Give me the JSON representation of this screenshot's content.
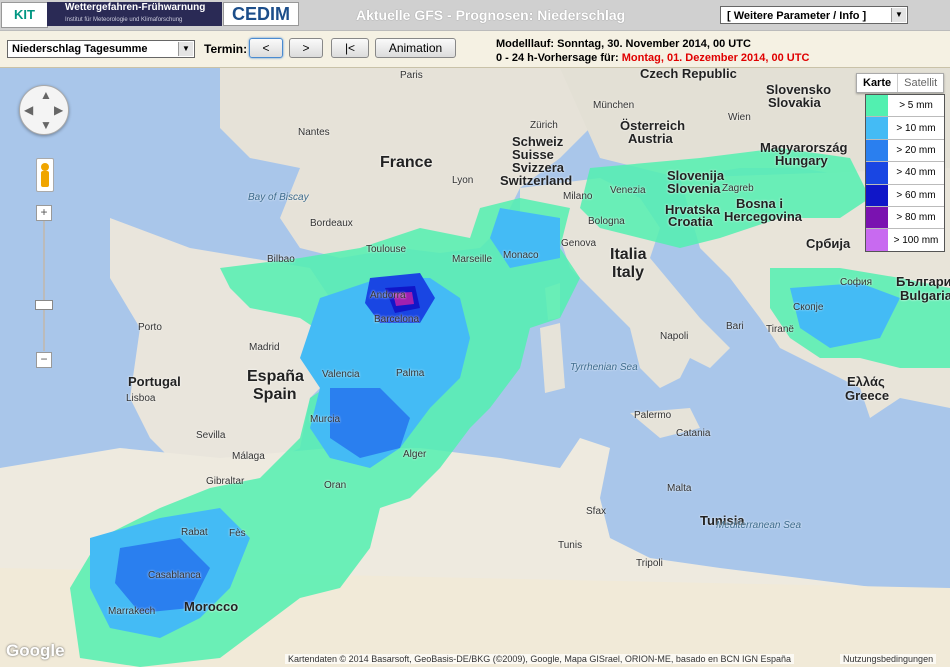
{
  "header": {
    "kit_logo": "KIT",
    "warn_logo_line1": "Wettergefahren-Frühwarnung",
    "warn_logo_line2": "Institut für Meteorologie und Klimaforschung",
    "cedim_logo": "CEDIM",
    "title": "Aktuelle GFS - Prognosen: Niederschlag",
    "param_select": "[ Weitere Parameter / Info ]"
  },
  "toolbar": {
    "mode_select": "Niederschlag Tagesumme",
    "termin_label": "Termin:",
    "prev_label": "<",
    "next_label": ">",
    "first_label": "|<",
    "animation_label": "Animation",
    "run_label": "Modelllauf: Sonntag, 30. November 2014, 00 UTC",
    "forecast_prefix": "0 - 24 h-Vorhersage für:",
    "forecast_date": "Montag, 01. Dezember 2014, 00 UTC"
  },
  "map": {
    "maptype_active": "Karte",
    "maptype_other": "Satellit",
    "legend": [
      {
        "label": "> 5 mm",
        "color": "#52f0b0"
      },
      {
        "label": "> 10 mm",
        "color": "#44bbf5"
      },
      {
        "label": "> 20 mm",
        "color": "#2a7fef"
      },
      {
        "label": "> 40 mm",
        "color": "#1946e3"
      },
      {
        "label": "> 60 mm",
        "color": "#1016c8"
      },
      {
        "label": "> 80 mm",
        "color": "#7a12b0"
      },
      {
        "label": "> 100 mm",
        "color": "#c86af0"
      }
    ],
    "labels": {
      "france": "France",
      "espana": "España",
      "spain": "Spain",
      "italia": "Italia",
      "italy": "Italy",
      "portugal": "Portugal",
      "schweiz": "Schweiz",
      "suisse": "Suisse",
      "svizzera": "Svizzera",
      "switzerland": "Switzerland",
      "ellas": "Ελλάς",
      "greece": "Greece",
      "czech": "Czech Republic",
      "osterreich": "Österreich",
      "austria": "Austria",
      "slovensko": "Slovensko",
      "slovakia": "Slovakia",
      "magyarorszag": "Magyarország",
      "hungary": "Hungary",
      "slovenija": "Slovenija",
      "slovenia": "Slovenia",
      "hrvatska": "Hrvatska",
      "croatia": "Croatia",
      "bosna": "Bosna i",
      "hercegovina": "Hercegovina",
      "srbija": "Србија",
      "balgaria": "Българи",
      "bulgaria": "Bulgaria",
      "morocco": "Morocco",
      "paris": "Paris",
      "nantes": "Nantes",
      "bordeaux": "Bordeaux",
      "toulouse": "Toulouse",
      "lyon": "Lyon",
      "marseille": "Marseille",
      "monaco": "Monaco",
      "genova": "Genova",
      "milano": "Milano",
      "venezia": "Venezia",
      "bologna": "Bologna",
      "zurich": "Zürich",
      "bilbao": "Bilbao",
      "madrid": "Madrid",
      "valencia": "Valencia",
      "barcelona": "Barcelona",
      "andorra": "Andorra",
      "palma": "Palma",
      "murcia": "Murcia",
      "sevilla": "Sevilla",
      "malaga": "Málaga",
      "gibraltar": "Gibraltar",
      "lisboa": "Lisboa",
      "porto": "Porto",
      "oran": "Oran",
      "alger": "Alger",
      "rabat": "Rabat",
      "fes": "Fès",
      "casablanca": "Casablanca",
      "marrakech": "Marrakech",
      "tunis": "Tunis",
      "tunisia": "Tunisia",
      "sfax": "Sfax",
      "tripoli": "Tripoli",
      "napoli": "Napoli",
      "bari": "Bari",
      "palermo": "Palermo",
      "catania": "Catania",
      "malta": "Malta",
      "tirane": "Tiranë",
      "sofia": "София",
      "skopje": "Скопје",
      "wien": "Wien",
      "zagreb": "Zagreb",
      "munchen": "München",
      "bay_biscay": "Bay of Biscay",
      "tyrrhenian": "Tyrrhenian Sea",
      "mediterranean": "Mediterranean Sea"
    },
    "google_logo": "Google",
    "attribution": "Kartendaten © 2014 Basarsoft, GeoBasis-DE/BKG (©2009), Google, Mapa GISrael, ORION-ME, basado en BCN IGN España",
    "terms": "Nutzungsbedingungen"
  }
}
